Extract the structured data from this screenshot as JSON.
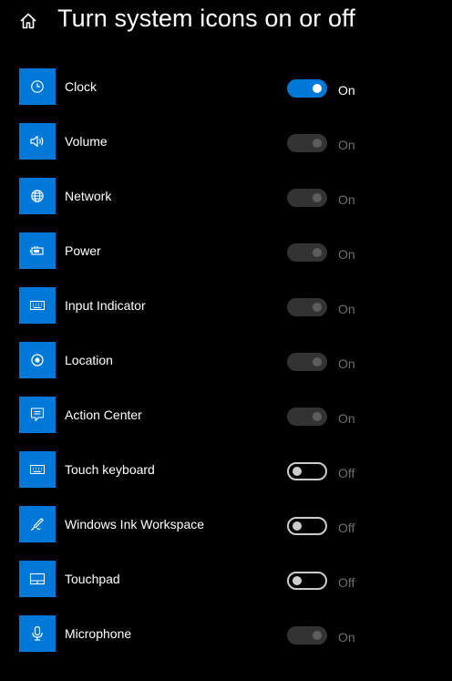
{
  "header": {
    "home_icon": "home-icon",
    "title": "Turn system icons on or off"
  },
  "colors": {
    "accent": "#0078d7",
    "background": "#000000",
    "disabled_track": "#333333",
    "dim_text": "#6e6e6e"
  },
  "items": [
    {
      "label": "Clock",
      "icon": "clock-icon",
      "state_label": "On",
      "state": "on"
    },
    {
      "label": "Volume",
      "icon": "volume-icon",
      "state_label": "On",
      "state": "disabled"
    },
    {
      "label": "Network",
      "icon": "globe-icon",
      "state_label": "On",
      "state": "disabled"
    },
    {
      "label": "Power",
      "icon": "battery-icon",
      "state_label": "On",
      "state": "disabled"
    },
    {
      "label": "Input Indicator",
      "icon": "keyboard-icon",
      "state_label": "On",
      "state": "disabled"
    },
    {
      "label": "Location",
      "icon": "location-icon",
      "state_label": "On",
      "state": "disabled"
    },
    {
      "label": "Action Center",
      "icon": "action-center-icon",
      "state_label": "On",
      "state": "disabled"
    },
    {
      "label": "Touch keyboard",
      "icon": "keyboard-icon",
      "state_label": "Off",
      "state": "off"
    },
    {
      "label": "Windows Ink Workspace",
      "icon": "pen-icon",
      "state_label": "Off",
      "state": "off"
    },
    {
      "label": "Touchpad",
      "icon": "touchpad-icon",
      "state_label": "Off",
      "state": "off"
    },
    {
      "label": "Microphone",
      "icon": "microphone-icon",
      "state_label": "On",
      "state": "disabled"
    }
  ]
}
